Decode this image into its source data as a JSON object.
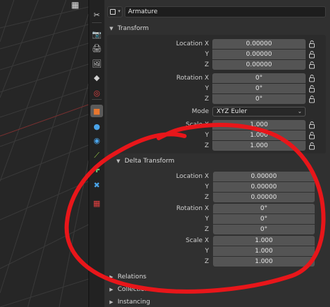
{
  "header": {
    "object_name": "Armature"
  },
  "tabs": [
    {
      "name": "tool-icon",
      "glyph": "✂"
    },
    {
      "name": "render-icon",
      "glyph": "📷"
    },
    {
      "name": "output-icon",
      "glyph": "🖨"
    },
    {
      "name": "view-layer-icon",
      "glyph": "🖼"
    },
    {
      "name": "scene-icon",
      "glyph": "◆"
    },
    {
      "name": "world-icon",
      "glyph": "◎"
    },
    {
      "name": "object-icon",
      "glyph": "■"
    },
    {
      "name": "modifier-icon",
      "glyph": "●"
    },
    {
      "name": "physics-icon",
      "glyph": "◉"
    },
    {
      "name": "constraint-icon",
      "glyph": "⟋"
    },
    {
      "name": "object-data-icon",
      "glyph": "✚"
    },
    {
      "name": "bone-icon",
      "glyph": "✖"
    },
    {
      "name": "texture-icon",
      "glyph": "▦"
    }
  ],
  "transform": {
    "title": "Transform",
    "location": {
      "label_x": "Location X",
      "label_y": "Y",
      "label_z": "Z",
      "x": "0.00000",
      "y": "0.00000",
      "z": "0.00000"
    },
    "rotation": {
      "label_x": "Rotation X",
      "label_y": "Y",
      "label_z": "Z",
      "x": "0°",
      "y": "0°",
      "z": "0°"
    },
    "mode": {
      "label": "Mode",
      "value": "XYZ Euler"
    },
    "scale": {
      "label_x": "Scale X",
      "label_y": "Y",
      "label_z": "Z",
      "x": "1.000",
      "y": "1.000",
      "z": "1.000"
    }
  },
  "delta_transform": {
    "title": "Delta Transform",
    "location": {
      "label_x": "Location X",
      "label_y": "Y",
      "label_z": "Z",
      "x": "0.00000",
      "y": "0.00000",
      "z": "0.00000"
    },
    "rotation": {
      "label_x": "Rotation X",
      "label_y": "Y",
      "label_z": "Z",
      "x": "0°",
      "y": "0°",
      "z": "0°"
    },
    "scale": {
      "label_x": "Scale X",
      "label_y": "Y",
      "label_z": "Z",
      "x": "1.000",
      "y": "1.000",
      "z": "1.000"
    }
  },
  "collapsed_panels": {
    "relations": "Relations",
    "collections": "Collections",
    "instancing": "Instancing"
  },
  "colors": {
    "annotation": "#e8161a",
    "active_tab": "#5a5a5a",
    "object_tab_icon": "#e8772e"
  }
}
